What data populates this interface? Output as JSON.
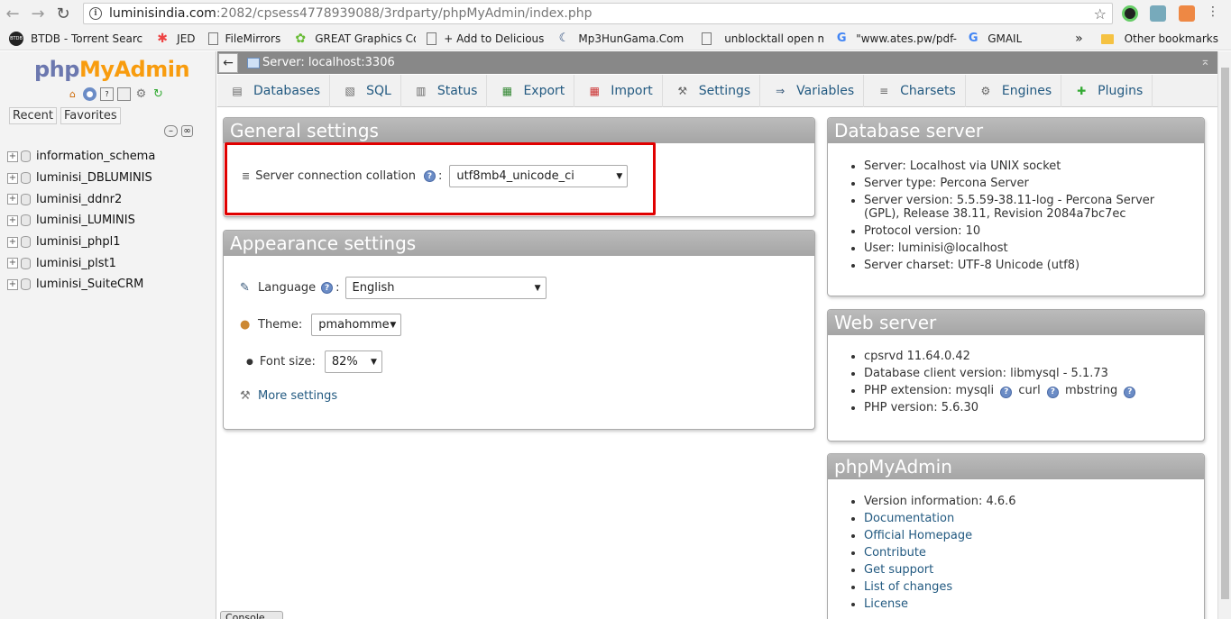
{
  "browser": {
    "url_host": "luminisindia.com",
    "url_path": ":2082/cpsess4778939088/3rdparty/phpMyAdmin/index.php",
    "bookmarks": [
      "BTDB - Torrent Searc",
      "JED",
      "FileMirrors",
      "GREAT Graphics Coll",
      "+ Add to Delicious",
      "Mp3HunGama.Com",
      "unblocktall open ma",
      "\"www.ates.pw/pdf-fi",
      "GMAIL"
    ],
    "overflow": "»",
    "other_bookmarks": "Other bookmarks",
    "btdb_badge": "BTDB"
  },
  "nav": {
    "logo_php": "php",
    "logo_myadmin": "MyAdmin",
    "recent": "Recent",
    "favorites": "Favorites",
    "databases": [
      "information_schema",
      "luminisi_DBLUMINIS",
      "luminisi_ddnr2",
      "luminisi_LUMINIS",
      "luminisi_phpl1",
      "luminisi_plst1",
      "luminisi_SuiteCRM"
    ]
  },
  "topbar": {
    "server": "Server: localhost:3306",
    "back": "←",
    "collapse": "⌅"
  },
  "menu": {
    "tabs": [
      "Databases",
      "SQL",
      "Status",
      "Export",
      "Import",
      "Settings",
      "Variables",
      "Charsets",
      "Engines",
      "Plugins"
    ]
  },
  "general": {
    "title": "General settings",
    "collation_label": "Server connection collation",
    "collation_value": "utf8mb4_unicode_ci"
  },
  "appearance": {
    "title": "Appearance settings",
    "language_label": "Language",
    "language_value": "English",
    "theme_label": "Theme:",
    "theme_value": "pmahomme",
    "fontsize_label": "Font size:",
    "fontsize_value": "82%",
    "more_settings": "More settings"
  },
  "dbserver": {
    "title": "Database server",
    "items": [
      "Server: Localhost via UNIX socket",
      "Server type: Percona Server",
      "Server version: 5.5.59-38.11-log - Percona Server (GPL), Release 38.11, Revision 2084a7bc7ec",
      "Protocol version: 10",
      "User: luminisi@localhost",
      "Server charset: UTF-8 Unicode (utf8)"
    ]
  },
  "webserver": {
    "title": "Web server",
    "cpsrvd": "cpsrvd 11.64.0.42",
    "client": "Database client version: libmysql - 5.1.73",
    "php_ext_label": "PHP extension: mysqli",
    "php_ext_curl": "curl",
    "php_ext_mbstring": "mbstring",
    "php_version": "PHP version: 5.6.30"
  },
  "pma": {
    "title": "phpMyAdmin",
    "version": "Version information: 4.6.6",
    "links": [
      "Documentation",
      "Official Homepage",
      "Contribute",
      "Get support",
      "List of changes",
      "License"
    ]
  },
  "console": "Console",
  "colors": {
    "accent": "#235a81",
    "highlight": "#e00000",
    "panel_header": "#a8a8a8"
  }
}
